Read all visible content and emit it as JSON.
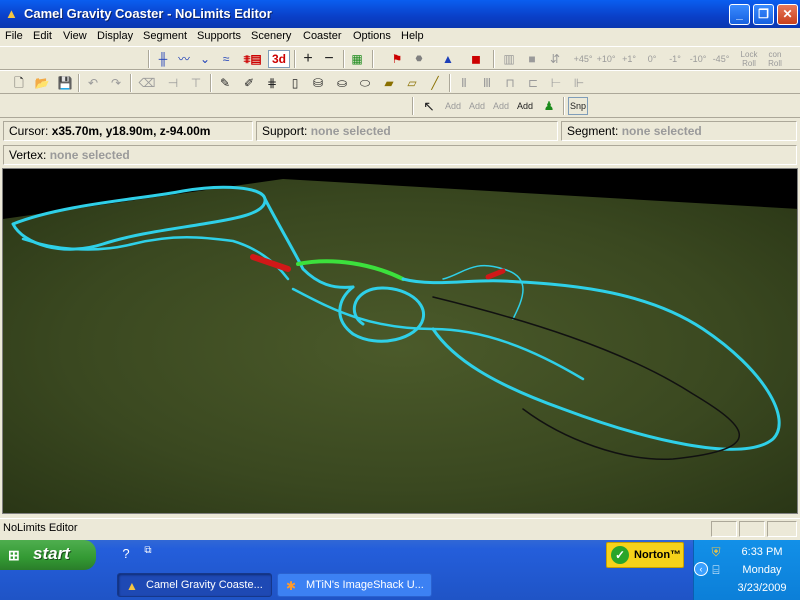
{
  "window": {
    "title": "Camel Gravity Coaster - NoLimits Editor",
    "controls": {
      "minimize": "_",
      "maximize": "❐",
      "close": "✕"
    }
  },
  "menu": [
    "File",
    "Edit",
    "View",
    "Display",
    "Segment",
    "Supports",
    "Scenery",
    "Coaster",
    "Options",
    "Help"
  ],
  "toolbar1": {
    "view_3d": "3d",
    "angles": [
      "+45°",
      "+10°",
      "+1°",
      "0°",
      "-1°",
      "-10°",
      "-45°"
    ],
    "lock_label": "Lock Roll",
    "con_roll_label": "con Roll"
  },
  "toolbar3": {
    "add_labels": [
      "Add",
      "Add",
      "Add",
      "Add"
    ],
    "snap_label": "Snp"
  },
  "status": {
    "cursor_label": "Cursor:",
    "cursor_value": "x35.70m, y18.90m, z-94.00m",
    "support_label": "Support:",
    "support_value": "none selected",
    "segment_label": "Segment:",
    "segment_value": "none selected",
    "vertex_label": "Vertex:",
    "vertex_value": "none selected"
  },
  "statusbar": {
    "text": "NoLimits Editor"
  },
  "colors": {
    "track": "#2fd0e8",
    "highlight_track": "#3ce03c",
    "ground": "#3d4a22",
    "brake": "#d01818"
  },
  "taskbar": {
    "start_label": "start",
    "norton_label": "Norton™",
    "tasks": [
      {
        "label": "Camel Gravity Coaste...",
        "active": true
      },
      {
        "label": "MTiN's ImageShack U...",
        "active": false
      }
    ],
    "clock": {
      "time": "6:33 PM",
      "day": "Monday",
      "date": "3/23/2009"
    }
  }
}
